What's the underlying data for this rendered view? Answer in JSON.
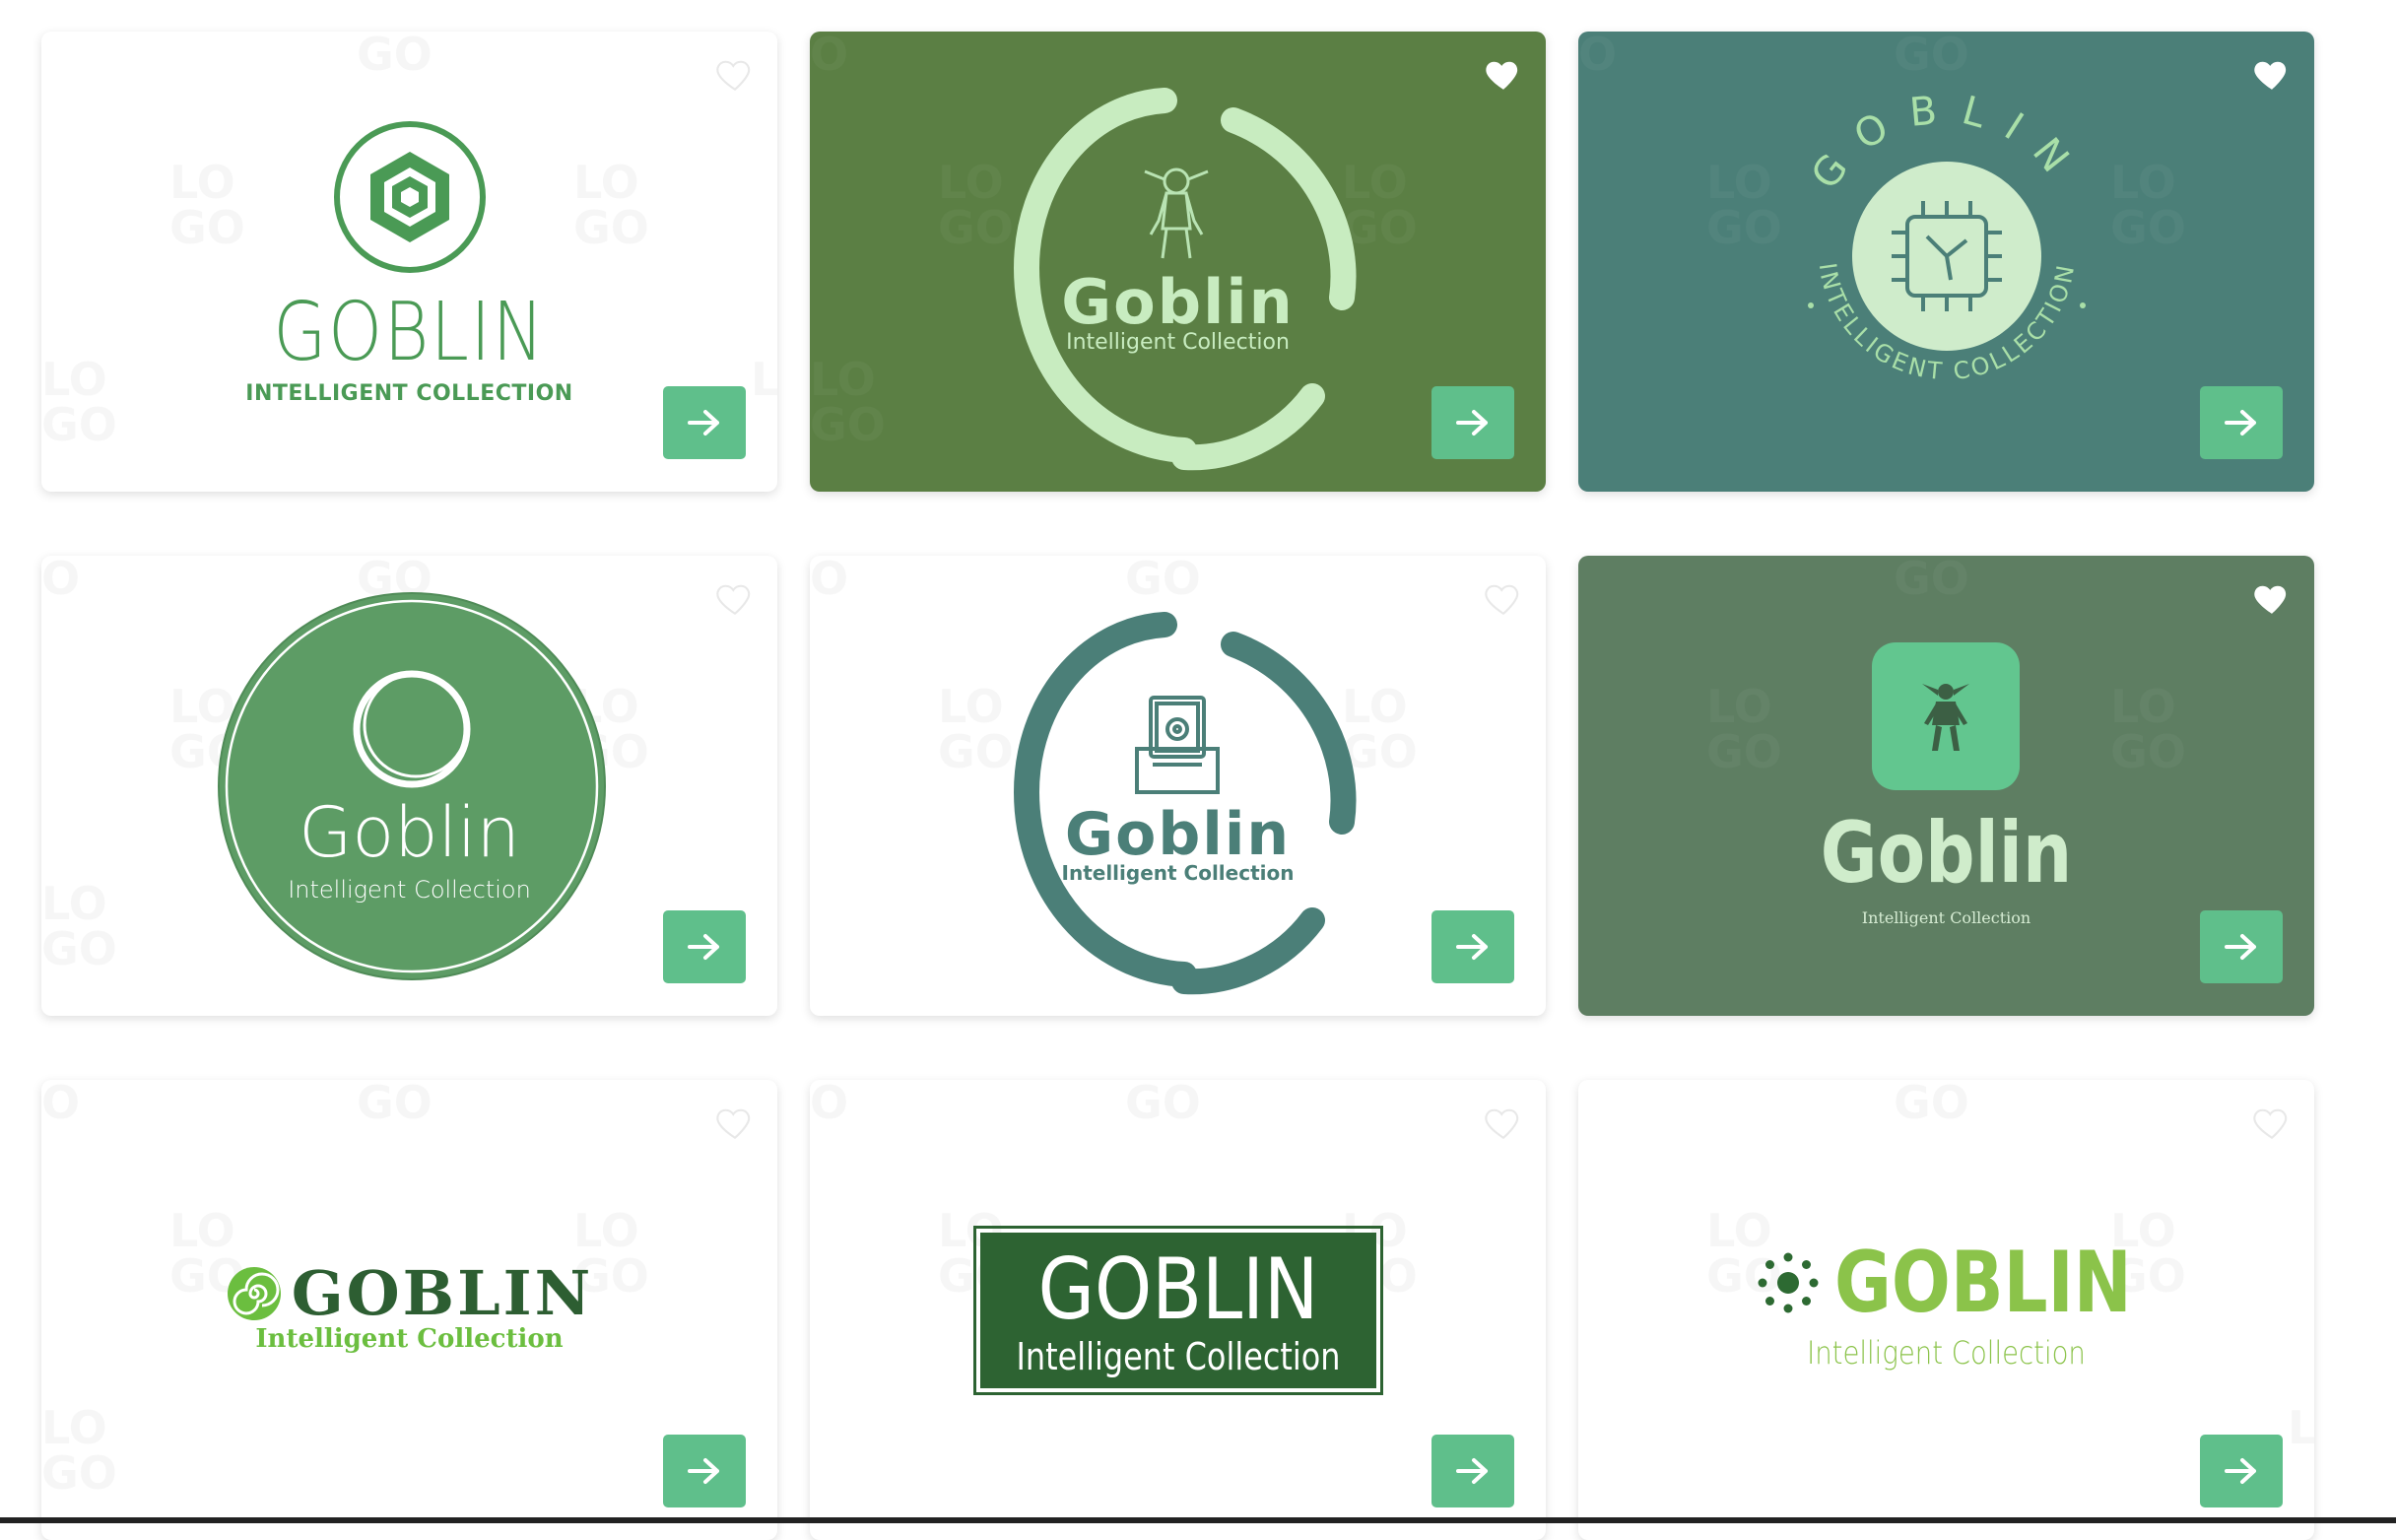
{
  "colors": {
    "accent_button": "#5fbf8b",
    "card_olive": "#5b7f44",
    "card_teal": "#4b7f78",
    "card_sage": "#5e7e62"
  },
  "icons": {
    "favorite": "heart-icon",
    "open": "arrow-right-icon"
  },
  "cards": [
    {
      "name": "GOBLIN",
      "tagline": "INTELLIGENT COLLECTION"
    },
    {
      "name": "Goblin",
      "tagline": "Intelligent Collection"
    },
    {
      "name": "GOBLIN",
      "tagline": "INTELLIGENT COLLECTION"
    },
    {
      "name": "Goblin",
      "tagline": "Intelligent Collection"
    },
    {
      "name": "Goblin",
      "tagline": "Intelligent Collection"
    },
    {
      "name": "Goblin",
      "tagline": "Intelligent Collection"
    },
    {
      "name": "GOBLIN",
      "tagline": "Intelligent Collection"
    },
    {
      "name": "GOBLIN",
      "tagline": "Intelligent Collection"
    },
    {
      "name": "GOBLIN",
      "tagline": "Intelligent Collection"
    }
  ]
}
